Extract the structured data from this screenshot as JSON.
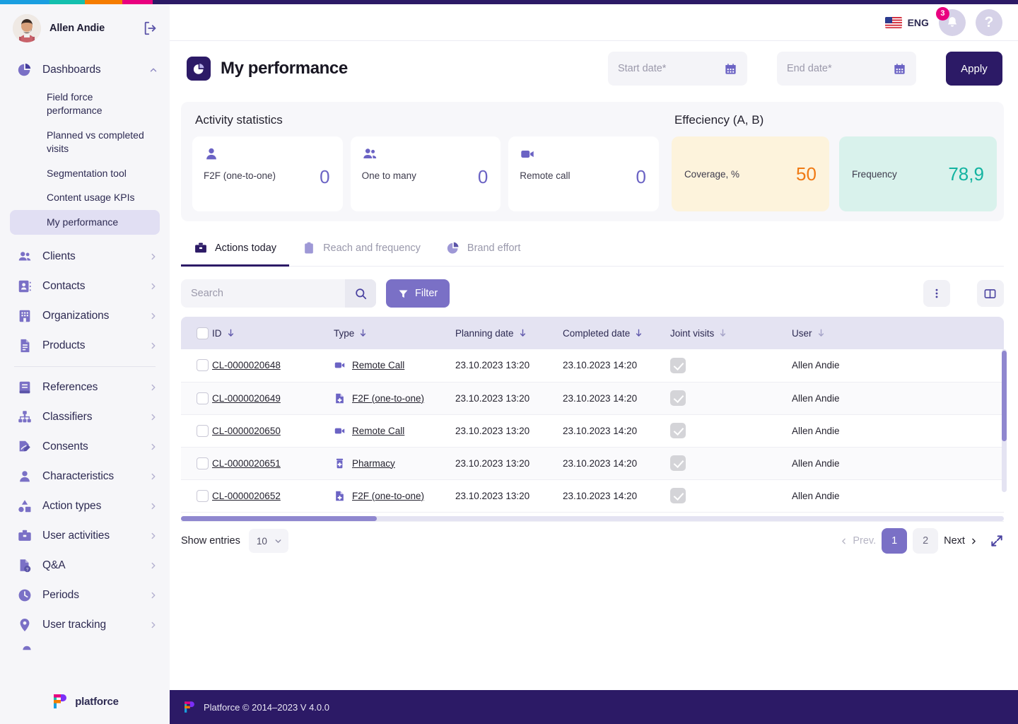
{
  "brand": {
    "name": "platforce",
    "accent": "#2c1a66"
  },
  "top_stripe_colors": [
    "#1a9ee0",
    "#14bfae",
    "#f57c00",
    "#e9007f",
    "#2c1a66"
  ],
  "sidebar": {
    "user": {
      "name": "Allen Andie",
      "avatar_icon": "user-avatar-photo",
      "logout_icon": "logout-icon"
    },
    "group": {
      "label": "Dashboards",
      "icon": "pie-chart-icon",
      "chevron": "chevron-up-icon",
      "items": [
        {
          "label": "Field force performance",
          "active": false
        },
        {
          "label": "Planned vs completed visits",
          "active": false
        },
        {
          "label": "Segmentation tool",
          "active": false
        },
        {
          "label": "Content usage KPIs",
          "active": false
        },
        {
          "label": "My performance",
          "active": true
        }
      ]
    },
    "items": [
      {
        "label": "Clients",
        "icon": "clients-icon",
        "chevron": "chevron-right-icon"
      },
      {
        "label": "Contacts",
        "icon": "contacts-icon",
        "chevron": "chevron-right-icon"
      },
      {
        "label": "Organizations",
        "icon": "organizations-icon",
        "chevron": "chevron-right-icon"
      },
      {
        "label": "Products",
        "icon": "products-icon",
        "chevron": "chevron-right-icon"
      },
      {
        "label": "References",
        "icon": "references-icon",
        "chevron": "chevron-right-icon",
        "separator_before": true
      },
      {
        "label": "Classifiers",
        "icon": "classifiers-icon",
        "chevron": "chevron-right-icon"
      },
      {
        "label": "Consents",
        "icon": "consents-icon",
        "chevron": "chevron-right-icon"
      },
      {
        "label": "Characteristics",
        "icon": "characteristics-icon",
        "chevron": "chevron-right-icon"
      },
      {
        "label": "Action types",
        "icon": "action-types-icon",
        "chevron": "chevron-right-icon"
      },
      {
        "label": "User activities",
        "icon": "user-activities-icon",
        "chevron": "chevron-right-icon"
      },
      {
        "label": "Q&A",
        "icon": "qa-icon",
        "chevron": "chevron-right-icon"
      },
      {
        "label": "Periods",
        "icon": "clock-icon",
        "chevron": "chevron-right-icon"
      },
      {
        "label": "User tracking",
        "icon": "map-pin-icon",
        "chevron": "chevron-right-icon"
      }
    ]
  },
  "topbar": {
    "language": {
      "label": "ENG",
      "flag": "us-flag-icon"
    },
    "notifications": {
      "count": "3",
      "icon": "bell-icon"
    },
    "help": {
      "label": "?",
      "icon": "help-icon"
    }
  },
  "page": {
    "title": "My performance",
    "icon": "pie-chart-icon",
    "start_date": {
      "placeholder": "Start date*",
      "value": "",
      "icon": "calendar-icon"
    },
    "end_date": {
      "placeholder": "End date*",
      "value": "",
      "icon": "calendar-icon"
    },
    "apply_label": "Apply"
  },
  "activity": {
    "title": "Activity statistics",
    "cards": [
      {
        "label": "F2F (one-to-one)",
        "value": "0",
        "icon": "person-icon"
      },
      {
        "label": "One to many",
        "value": "0",
        "icon": "people-icon"
      },
      {
        "label": "Remote call",
        "value": "0",
        "icon": "video-camera-icon"
      }
    ]
  },
  "efficiency": {
    "title": "Effeciency (A, B)",
    "cards": [
      {
        "label": "Coverage, %",
        "value": "50",
        "color": "#f07a14",
        "bg": "#fdf3dc"
      },
      {
        "label": "Frequency",
        "value": "78,9",
        "color": "#13b3a0",
        "bg": "#d9f2ec"
      }
    ]
  },
  "tabs": [
    {
      "label": "Actions today",
      "icon": "briefcase-icon",
      "active": true
    },
    {
      "label": "Reach and frequency",
      "icon": "clipboard-icon",
      "active": false
    },
    {
      "label": "Brand effort",
      "icon": "pie-chart-icon",
      "active": false
    }
  ],
  "toolbar": {
    "search_placeholder": "Search",
    "search_value": "",
    "search_icon": "search-icon",
    "filter_label": "Filter",
    "filter_icon": "funnel-icon",
    "more_icon": "more-vertical-icon",
    "columns_icon": "columns-icon"
  },
  "table": {
    "columns": [
      {
        "key": "checkbox",
        "label": "",
        "sortable": false
      },
      {
        "key": "id",
        "label": "ID",
        "sortable": true
      },
      {
        "key": "type",
        "label": "Type",
        "sortable": true
      },
      {
        "key": "planning_date",
        "label": "Planning date",
        "sortable": true
      },
      {
        "key": "completed_date",
        "label": "Completed date",
        "sortable": true
      },
      {
        "key": "joint_visits",
        "label": "Joint visits",
        "sortable": true
      },
      {
        "key": "user",
        "label": "User",
        "sortable": true
      }
    ],
    "rows": [
      {
        "id": "CL-0000020648",
        "type": "Remote Call",
        "type_icon": "video-camera-icon",
        "planning_date": "23.10.2023 13:20",
        "completed_date": "23.10.2023 14:20",
        "joint_visits": true,
        "user": "Allen Andie"
      },
      {
        "id": "CL-0000020649",
        "type": "F2F (one-to-one)",
        "type_icon": "medical-file-icon",
        "planning_date": "23.10.2023 13:20",
        "completed_date": "23.10.2023 14:20",
        "joint_visits": true,
        "user": "Allen Andie"
      },
      {
        "id": "CL-0000020650",
        "type": "Remote Call",
        "type_icon": "video-camera-icon",
        "planning_date": "23.10.2023 13:20",
        "completed_date": "23.10.2023 14:20",
        "joint_visits": true,
        "user": "Allen Andie"
      },
      {
        "id": "CL-0000020651",
        "type": "Pharmacy",
        "type_icon": "pill-bottle-icon",
        "planning_date": "23.10.2023 13:20",
        "completed_date": "23.10.2023 14:20",
        "joint_visits": true,
        "user": "Allen Andie"
      },
      {
        "id": "CL-0000020652",
        "type": "F2F (one-to-one)",
        "type_icon": "medical-file-icon",
        "planning_date": "23.10.2023 13:20",
        "completed_date": "23.10.2023 14:20",
        "joint_visits": true,
        "user": "Allen Andie"
      }
    ]
  },
  "pagination": {
    "show_entries_label": "Show entries",
    "page_size": "10",
    "prev_label": "Prev.",
    "next_label": "Next",
    "pages": [
      "1",
      "2"
    ],
    "current_page": "1",
    "expand_icon": "expand-icon"
  },
  "footer": {
    "text": "Platforce © 2014–2023 V 4.0.0",
    "logo": "platforce-logo-icon"
  }
}
